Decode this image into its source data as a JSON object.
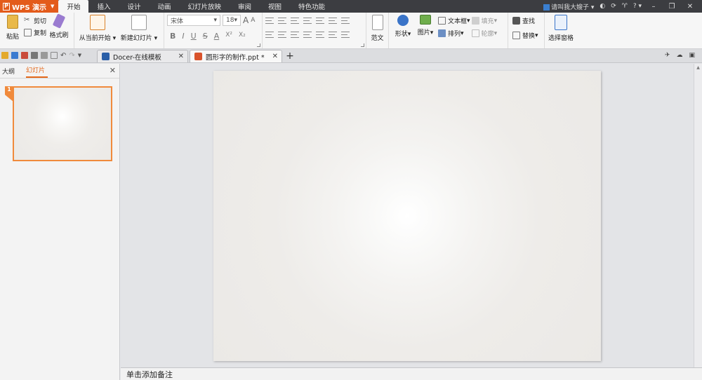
{
  "app": {
    "name": "WPS 演示"
  },
  "menu": {
    "tabs": [
      "开始",
      "插入",
      "设计",
      "动画",
      "幻灯片放映",
      "审阅",
      "视图",
      "特色功能"
    ],
    "active": "开始"
  },
  "title_bar": {
    "user": "请叫我大嫂子",
    "help": "?"
  },
  "ribbon": {
    "paste": "粘贴",
    "cut": "剪切",
    "copy": "复制",
    "format_painter": "格式刷",
    "play_from_current": "从当前开始",
    "new_slide": "新建幻灯片",
    "font_name": "宋体",
    "font_size": "18",
    "bold": "B",
    "italic": "I",
    "underline": "U",
    "strikethrough": "S",
    "font_color": "A",
    "superscript": "X²",
    "subscript": "X₂",
    "grow_font": "A",
    "shrink_font": "A",
    "template": "范文",
    "shapes": "形状",
    "picture": "图片",
    "textbox": "文本框",
    "arrange": "排列",
    "fill": "填充",
    "outline": "轮廓",
    "find": "查找",
    "replace": "替换",
    "selection_pane": "选择窗格"
  },
  "doc_tabs": [
    {
      "label": "Docer-在线模板",
      "active": false
    },
    {
      "label": "圆形字的制作.ppt *",
      "active": true
    }
  ],
  "left_panel": {
    "tabs": [
      "大纲",
      "幻灯片"
    ],
    "active": "幻灯片",
    "slide_number": "1"
  },
  "notes": {
    "placeholder": "单击添加备注"
  },
  "colors": {
    "accent": "#e35b1b",
    "thumb_border": "#f08a3c",
    "titlebar": "#3c3d41"
  }
}
